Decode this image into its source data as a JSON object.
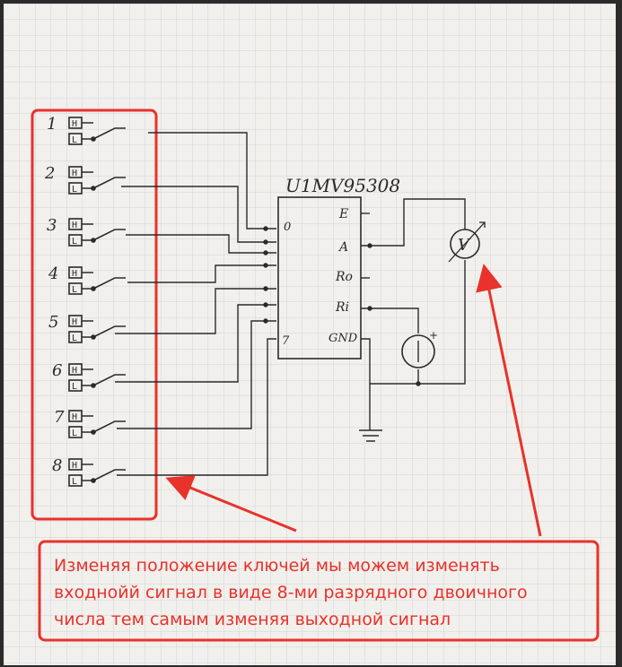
{
  "chip_label": "U1MV95308",
  "switch_numbers": [
    "1",
    "2",
    "3",
    "4",
    "5",
    "6",
    "7",
    "8"
  ],
  "switch_high_label": "H",
  "switch_low_label": "L",
  "chip_pins": {
    "in_first": "0",
    "in_last": "7",
    "e": "E",
    "a": "A",
    "ro": "Ro",
    "ri": "Ri",
    "gnd": "GND"
  },
  "voltmeter_symbol": "V",
  "source_polarity": "+",
  "annotation_lines": [
    "Изменяя положение ключей мы можем изменять",
    "входнойй сигнал в виде 8-ми разрядного двоичного",
    "числа тем самым изменяя выходной сигнал"
  ],
  "colors": {
    "annotation": "#e8322b",
    "ink": "#2a2a2a",
    "paper": "#f1f0ec",
    "grid": "#c9ccd2"
  }
}
